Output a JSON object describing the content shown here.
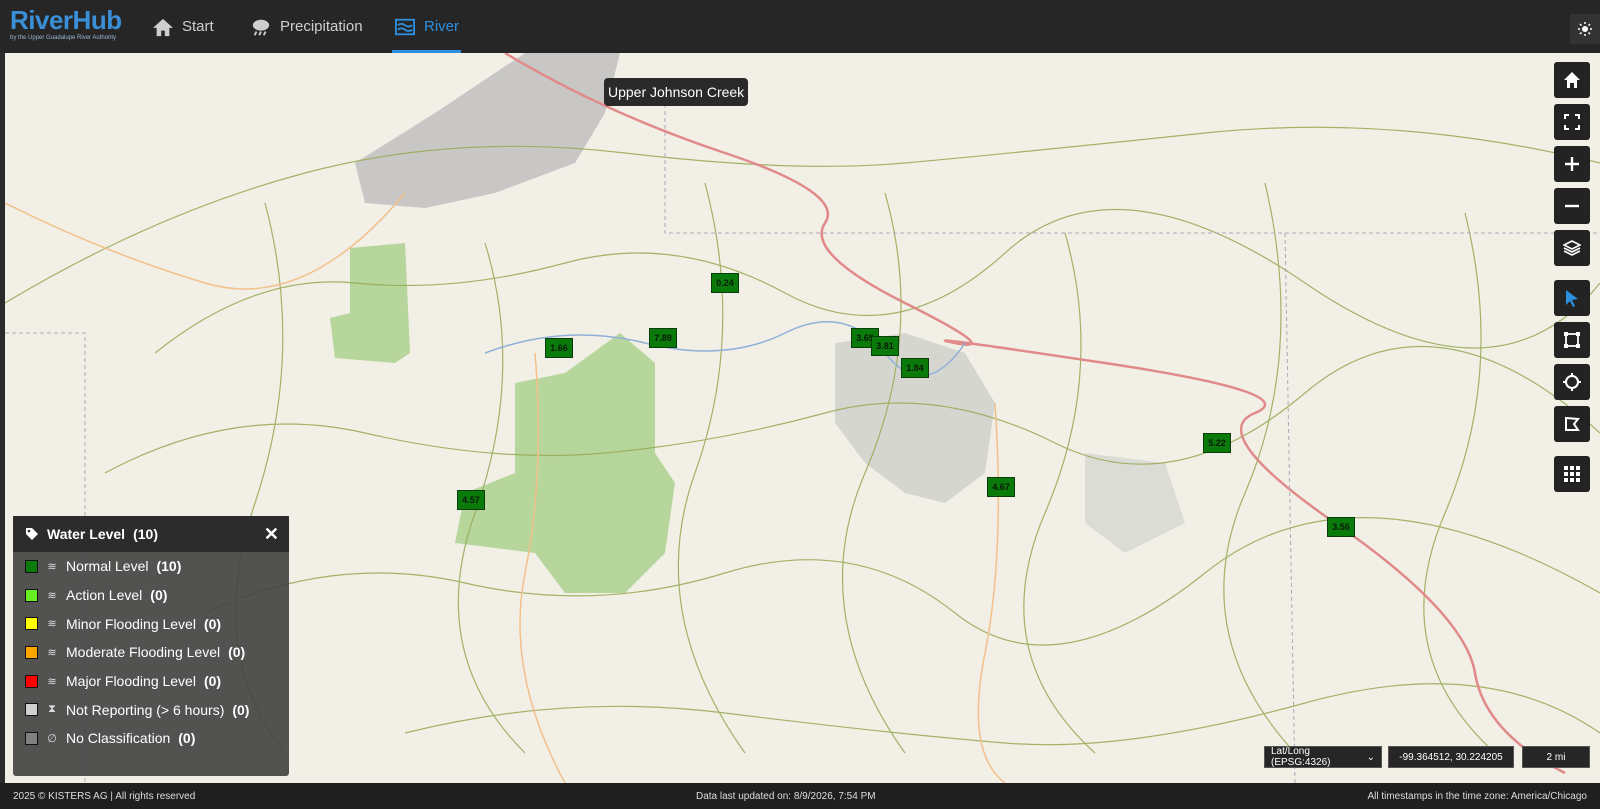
{
  "app": {
    "logo_name": "RiverHub",
    "logo_sub": "by the Upper Guadalupe River Authority",
    "accent": "#2d8fe0"
  },
  "nav": {
    "start": "Start",
    "precipitation": "Precipitation",
    "river": "River"
  },
  "map": {
    "tooltip": "Upper Johnson Creek",
    "markers": [
      "0.24",
      "1.66",
      "7.89",
      "3.65",
      "3.81",
      "1.84",
      "5.22",
      "4.57",
      "4.67",
      "3.56"
    ],
    "marker_color": "#0a7a0a"
  },
  "toolbar": {
    "icons": [
      "home-icon",
      "fullscreen-icon",
      "zoom-in-icon",
      "zoom-out-icon",
      "layers-icon",
      "pointer-icon",
      "select-rectangle-icon",
      "select-circle-icon",
      "select-polygon-icon",
      "grid-icon"
    ]
  },
  "legend": {
    "title": "Water Level",
    "title_count": "(10)",
    "rows": [
      {
        "label": "Normal Level",
        "count": "(10)",
        "color": "#0a7a0a",
        "icon": "river-icon"
      },
      {
        "label": "Action Level",
        "count": "(0)",
        "color": "#66ee22",
        "icon": "river-icon"
      },
      {
        "label": "Minor Flooding Level",
        "count": "(0)",
        "color": "#ffff00",
        "icon": "river-icon"
      },
      {
        "label": "Moderate Flooding Level",
        "count": "(0)",
        "color": "#ffa500",
        "icon": "river-icon"
      },
      {
        "label": "Major Flooding Level",
        "count": "(0)",
        "color": "#ff0000",
        "icon": "river-icon"
      },
      {
        "label": "Not Reporting (> 6 hours)",
        "count": "(0)",
        "color": "#d0d0d0",
        "icon": "hourglass-icon"
      },
      {
        "label": "No Classification",
        "count": "(0)",
        "color": "#808080",
        "icon": "empty-set-icon"
      }
    ]
  },
  "coords": {
    "projection": "Lat/Long (EPSG:4326)",
    "position": "-99.364512, 30.224205",
    "scale": "2 mi"
  },
  "footer": {
    "copyright": "2025 © KISTERS AG | All rights reserved",
    "updated": "Data last updated on: 8/9/2026, 7:54 PM",
    "timezone": "All timestamps in the time zone: America/Chicago"
  }
}
